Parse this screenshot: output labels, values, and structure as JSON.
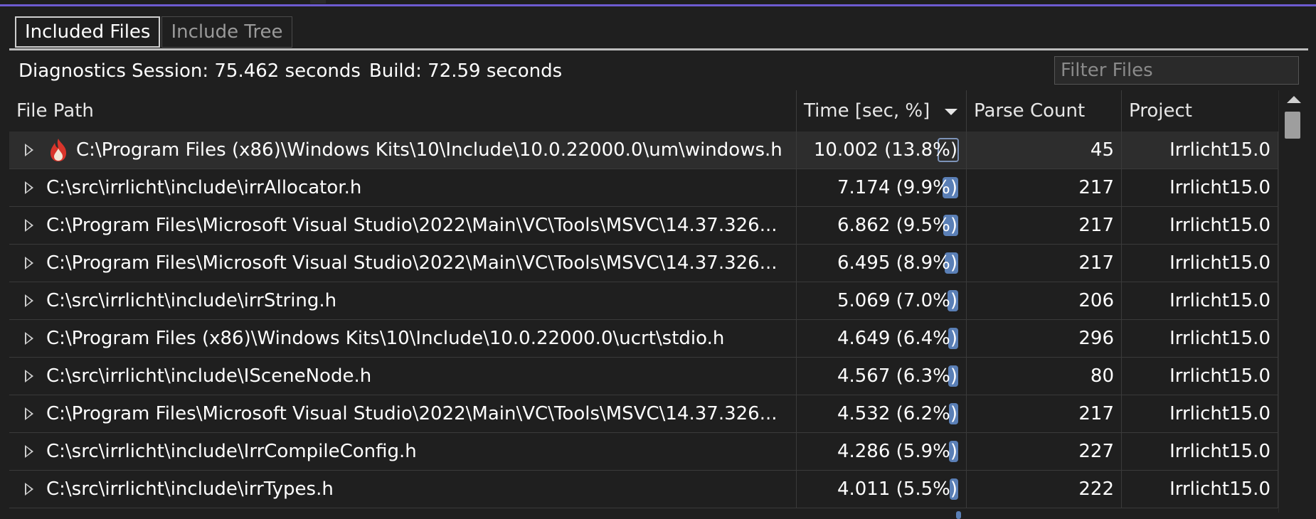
{
  "tabs": [
    {
      "label": "Included Files",
      "active": true
    },
    {
      "label": "Include Tree",
      "active": false
    }
  ],
  "session": {
    "diagnostics": "Diagnostics Session: 75.462 seconds",
    "build": "Build: 72.59 seconds"
  },
  "filter": {
    "placeholder": "Filter Files",
    "value": ""
  },
  "columns": {
    "file_path": "File Path",
    "time": "Time [sec, %]",
    "parse_count": "Parse Count",
    "project": "Project",
    "sort_column": "time",
    "sort_direction": "descending"
  },
  "rows": [
    {
      "path": "C:\\Program Files (x86)\\Windows Kits\\10\\Include\\10.0.22000.0\\um\\windows.h",
      "time": "10.002 (13.8%)",
      "pct": 13.8,
      "count": "45",
      "project": "Irrlicht15.0",
      "hot": true,
      "selected": true
    },
    {
      "path": "C:\\src\\irrlicht\\include\\irrAllocator.h",
      "time": "7.174 (9.9%)",
      "pct": 9.9,
      "count": "217",
      "project": "Irrlicht15.0"
    },
    {
      "path": "C:\\Program Files\\Microsoft Visual Studio\\2022\\Main\\VC\\Tools\\MSVC\\14.37.326...",
      "time": "6.862 (9.5%)",
      "pct": 9.5,
      "count": "217",
      "project": "Irrlicht15.0"
    },
    {
      "path": "C:\\Program Files\\Microsoft Visual Studio\\2022\\Main\\VC\\Tools\\MSVC\\14.37.326...",
      "time": "6.495 (8.9%)",
      "pct": 8.9,
      "count": "217",
      "project": "Irrlicht15.0"
    },
    {
      "path": "C:\\src\\irrlicht\\include\\irrString.h",
      "time": "5.069 (7.0%)",
      "pct": 7.0,
      "count": "206",
      "project": "Irrlicht15.0"
    },
    {
      "path": "C:\\Program Files (x86)\\Windows Kits\\10\\Include\\10.0.22000.0\\ucrt\\stdio.h",
      "time": "4.649 (6.4%)",
      "pct": 6.4,
      "count": "296",
      "project": "Irrlicht15.0"
    },
    {
      "path": "C:\\src\\irrlicht\\include\\ISceneNode.h",
      "time": "4.567 (6.3%)",
      "pct": 6.3,
      "count": "80",
      "project": "Irrlicht15.0"
    },
    {
      "path": "C:\\Program Files\\Microsoft Visual Studio\\2022\\Main\\VC\\Tools\\MSVC\\14.37.326...",
      "time": "4.532 (6.2%)",
      "pct": 6.2,
      "count": "217",
      "project": "Irrlicht15.0"
    },
    {
      "path": "C:\\src\\irrlicht\\include\\IrrCompileConfig.h",
      "time": "4.286 (5.9%)",
      "pct": 5.9,
      "count": "227",
      "project": "Irrlicht15.0"
    },
    {
      "path": "C:\\src\\irrlicht\\include\\irrTypes.h",
      "time": "4.011 (5.5%)",
      "pct": 5.5,
      "count": "222",
      "project": "Irrlicht15.0"
    }
  ],
  "icons": {
    "expander": "chevron-right-icon",
    "hot": "flame-icon",
    "sort": "sort-descending-icon",
    "scroll_up": "scroll-up-icon"
  },
  "colors": {
    "accent": "#6d5bd0",
    "bar": "#5a7fb6",
    "hot": "#d9352b"
  }
}
